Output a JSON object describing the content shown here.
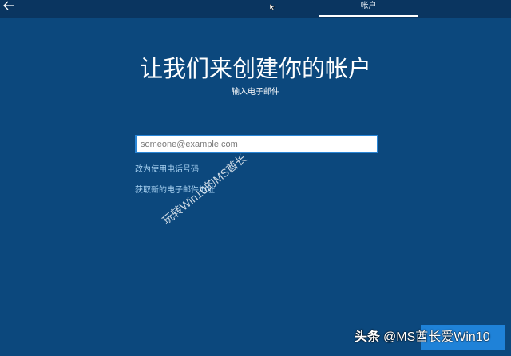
{
  "header": {
    "back_icon": "back-arrow-icon",
    "cursor_icon": "mouse-cursor-icon",
    "active_tab": "帐户"
  },
  "main": {
    "title": "让我们来创建你的帐户",
    "subtitle": "输入电子邮件",
    "email_input": {
      "value": "",
      "placeholder": "someone@example.com"
    },
    "links": [
      {
        "label": "改为使用电话号码"
      },
      {
        "label": "获取新的电子邮件地址"
      }
    ]
  },
  "watermarks": {
    "diagonal": "玩转Win10的MS酋长",
    "corner_brand": "头条",
    "corner_handle": "@MS酋长爱Win10"
  },
  "colors": {
    "background": "#0c487d",
    "header": "#0a3560",
    "accent": "#1f82d8",
    "link": "#a8d2f2",
    "input_border": "#2a86d6"
  }
}
